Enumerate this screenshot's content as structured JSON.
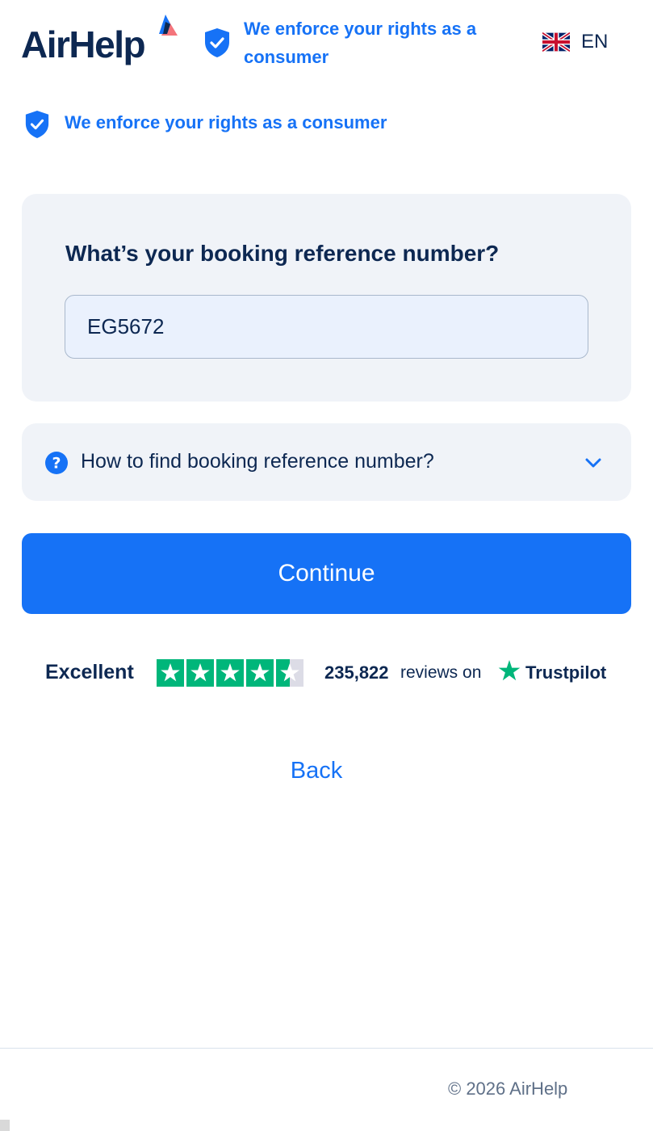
{
  "header": {
    "logo_text": "AirHelp",
    "trust_text": "We enforce your rights as a consumer",
    "language_code": "EN",
    "language_flag": "uk-flag-icon"
  },
  "trust_line": {
    "text": "We enforce your rights as a consumer"
  },
  "form": {
    "question": "What’s your booking reference number?",
    "booking_reference_value": "EG5672",
    "booking_reference_placeholder": ""
  },
  "help": {
    "label": "How to find booking reference number?",
    "expanded": false
  },
  "actions": {
    "continue_label": "Continue",
    "back_label": "Back"
  },
  "trustpilot": {
    "rating_word": "Excellent",
    "stars": 4.5,
    "stars_max": 5,
    "review_count": "235,822",
    "reviews_suffix": "reviews on",
    "brand": "Trustpilot"
  },
  "footer": {
    "copyright": "© 2026 AirHelp"
  },
  "colors": {
    "primary": "#1672f6",
    "navy": "#0d2852",
    "panel": "#f0f3f8",
    "trustpilot_green": "#00b67a",
    "star_empty": "#dcdce6"
  }
}
